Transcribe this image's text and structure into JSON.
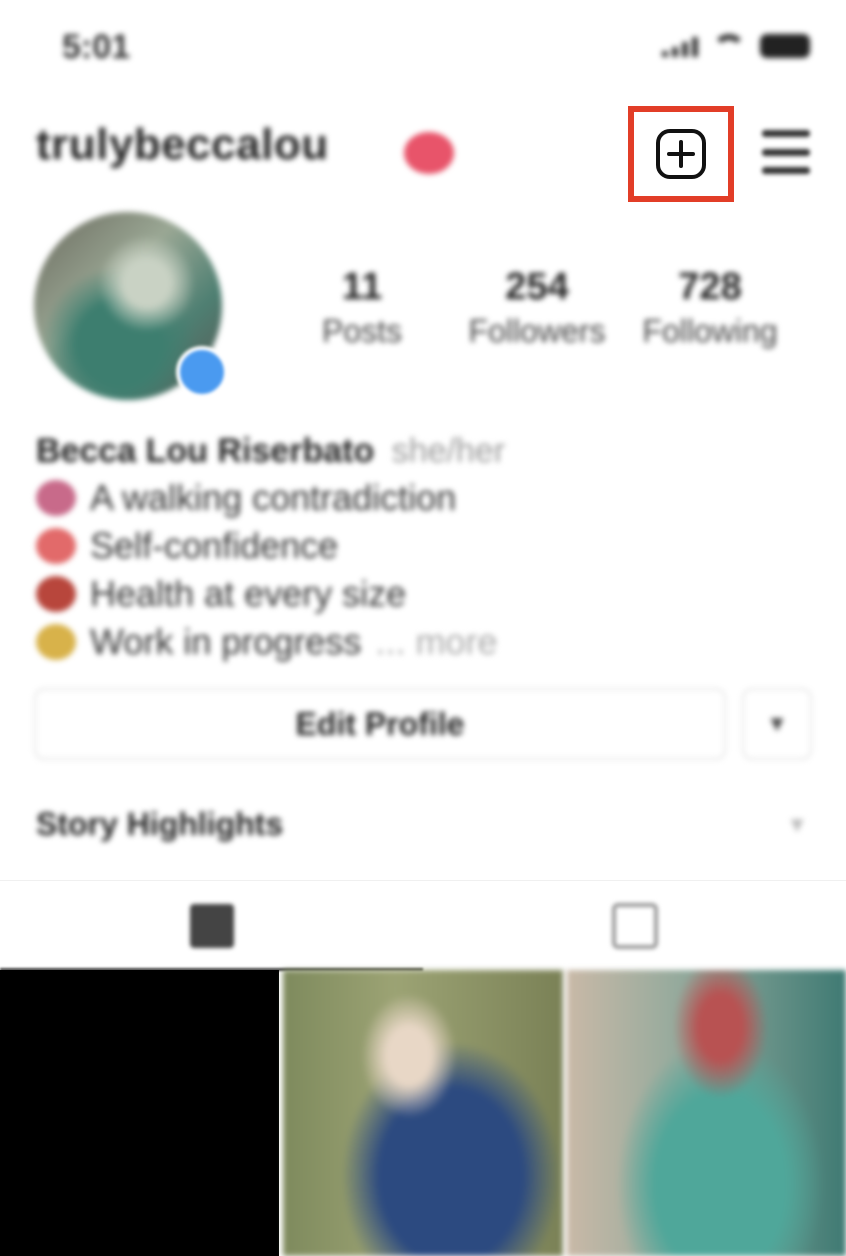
{
  "status_bar": {
    "time": "5:01"
  },
  "header": {
    "username": "trulybeccalou",
    "add_icon": "plus-square-icon",
    "menu_icon": "hamburger-menu-icon",
    "highlight_color": "#e23d27"
  },
  "profile": {
    "stats": [
      {
        "value": "11",
        "label": "Posts"
      },
      {
        "value": "254",
        "label": "Followers"
      },
      {
        "value": "728",
        "label": "Following"
      }
    ],
    "name": "Becca Lou Riserbato",
    "pronouns": "she/her",
    "bio_lines": [
      "A walking contradiction",
      "Self-confidence",
      "Health at every size",
      "Work in progress"
    ],
    "more_label": "... more",
    "edit_profile_label": "Edit Profile",
    "story_highlights_label": "Story Highlights"
  }
}
